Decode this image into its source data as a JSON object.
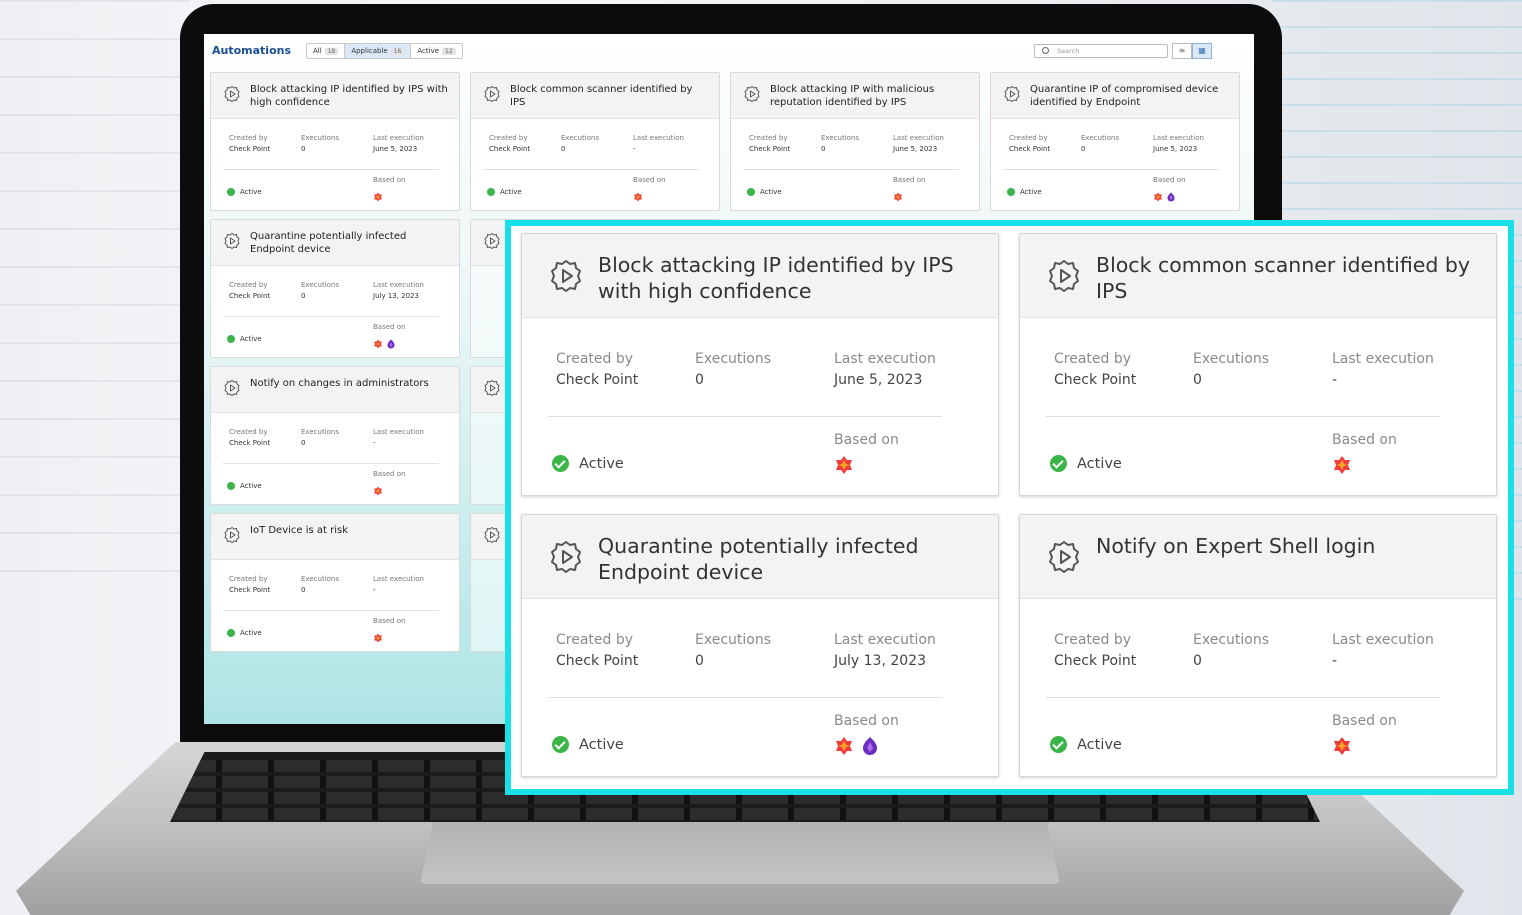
{
  "app": {
    "title": "Automations",
    "tabs": [
      {
        "label": "All",
        "count": "18"
      },
      {
        "label": "Applicable",
        "count": "16",
        "selected": true
      },
      {
        "label": "Active",
        "count": "12"
      }
    ],
    "search_placeholder": "Search",
    "view_list_icon": "list-view-icon",
    "view_grid_icon": "grid-view-icon"
  },
  "field_labels": {
    "created_by": "Created by",
    "executions": "Executions",
    "last_execution": "Last execution",
    "based_on": "Based on"
  },
  "badge_names": {
    "ips": "ips-blade-icon",
    "endpoint": "endpoint-blade-icon"
  },
  "colors": {
    "active_green": "#3bb54a",
    "highlight": "#19dfe6",
    "accent": "#1b4f93"
  },
  "mini_cards": [
    {
      "title": "Block attacking IP identified by IPS with high confidence",
      "created_by": "Check Point",
      "executions": "0",
      "last_execution": "June 5, 2023",
      "status": "Active",
      "badges": [
        "ips"
      ]
    },
    {
      "title": "Block common scanner identified by IPS",
      "created_by": "Check Point",
      "executions": "0",
      "last_execution": "-",
      "status": "Active",
      "badges": [
        "ips"
      ]
    },
    {
      "title": "Block attacking IP with malicious reputation identified by IPS",
      "created_by": "Check Point",
      "executions": "0",
      "last_execution": "June 5, 2023",
      "status": "Active",
      "badges": [
        "ips"
      ]
    },
    {
      "title": "Quarantine IP of compromised device identified by Endpoint",
      "created_by": "Check Point",
      "executions": "0",
      "last_execution": "June 5, 2023",
      "status": "Active",
      "badges": [
        "ips",
        "endpoint"
      ]
    },
    {
      "title": "Quarantine potentially infected Endpoint device",
      "created_by": "Check Point",
      "executions": "0",
      "last_execution": "July 13, 2023",
      "status": "Active",
      "badges": [
        "ips",
        "endpoint"
      ]
    },
    {
      "title": "Notify on changes in administrators",
      "created_by": "Check Point",
      "executions": "0",
      "last_execution": "-",
      "status": "Active",
      "badges": [
        "ips"
      ]
    },
    {
      "title": "IoT Device is at risk",
      "created_by": "Check Point",
      "executions": "0",
      "last_execution": "-",
      "status": "Active",
      "badges": [
        "ips"
      ]
    }
  ],
  "zoom_cards": [
    {
      "title": "Block attacking IP identified by IPS with high confidence",
      "created_by": "Check Point",
      "executions": "0",
      "last_execution": "June 5, 2023",
      "status": "Active",
      "badges": [
        "ips"
      ]
    },
    {
      "title": "Block common scanner identified by IPS",
      "created_by": "Check Point",
      "executions": "0",
      "last_execution": "-",
      "status": "Active",
      "badges": [
        "ips"
      ]
    },
    {
      "title": "Quarantine potentially infected Endpoint device",
      "created_by": "Check Point",
      "executions": "0",
      "last_execution": "July 13, 2023",
      "status": "Active",
      "badges": [
        "ips",
        "endpoint"
      ]
    },
    {
      "title": "Notify on Expert Shell login",
      "created_by": "Check Point",
      "executions": "0",
      "last_execution": "-",
      "status": "Active",
      "badges": [
        "ips"
      ]
    }
  ]
}
